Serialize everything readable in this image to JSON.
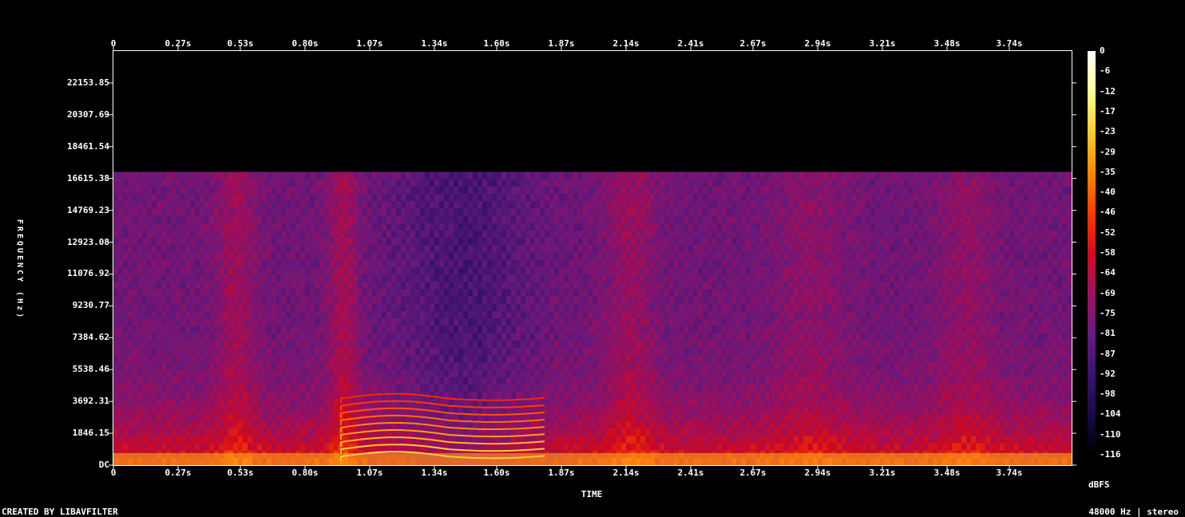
{
  "footer": {
    "created_by": "CREATED BY LIBAVFILTER",
    "sample_info": "48000 Hz | stereo"
  },
  "chart_data": {
    "type": "heatmap",
    "title": "",
    "xlabel": "TIME",
    "ylabel": "FREQUENCY (Hz)",
    "x_ticks": [
      "0",
      "0.27s",
      "0.53s",
      "0.80s",
      "1.07s",
      "1.34s",
      "1.60s",
      "1.87s",
      "2.14s",
      "2.41s",
      "2.67s",
      "2.94s",
      "3.21s",
      "3.48s",
      "3.74s"
    ],
    "x_tick_values": [
      0,
      0.27,
      0.53,
      0.8,
      1.07,
      1.34,
      1.6,
      1.87,
      2.14,
      2.41,
      2.67,
      2.94,
      3.21,
      3.48,
      3.74
    ],
    "xlim": [
      0,
      4.0
    ],
    "y_ticks": [
      "DC",
      "1846.15",
      "3692.31",
      "5538.46",
      "7384.62",
      "9230.77",
      "11076.92",
      "12923.08",
      "14769.23",
      "16615.38",
      "18461.54",
      "20307.69",
      "22153.85"
    ],
    "y_tick_values": [
      0,
      1846.15,
      3692.31,
      5538.46,
      7384.62,
      9230.77,
      11076.92,
      12923.08,
      14769.23,
      16615.38,
      18461.54,
      20307.69,
      22153.85
    ],
    "ylim": [
      0,
      24000
    ],
    "colorbar": {
      "label": "dBFS",
      "ticks": [
        "0",
        "-6",
        "-12",
        "-17",
        "-23",
        "-29",
        "-35",
        "-40",
        "-46",
        "-52",
        "-58",
        "-64",
        "-69",
        "-75",
        "-81",
        "-87",
        "-92",
        "-98",
        "-104",
        "-110",
        "-116"
      ],
      "range": [
        -120,
        0
      ],
      "colors": [
        "#000000",
        "#1a0a4a",
        "#3a1370",
        "#6a1a80",
        "#a01060",
        "#d50a20",
        "#ff3a00",
        "#ff8a00",
        "#ffcc30",
        "#ffff90",
        "#ffffff"
      ]
    },
    "cutoff_hz": 17000,
    "background_db": -82
  }
}
